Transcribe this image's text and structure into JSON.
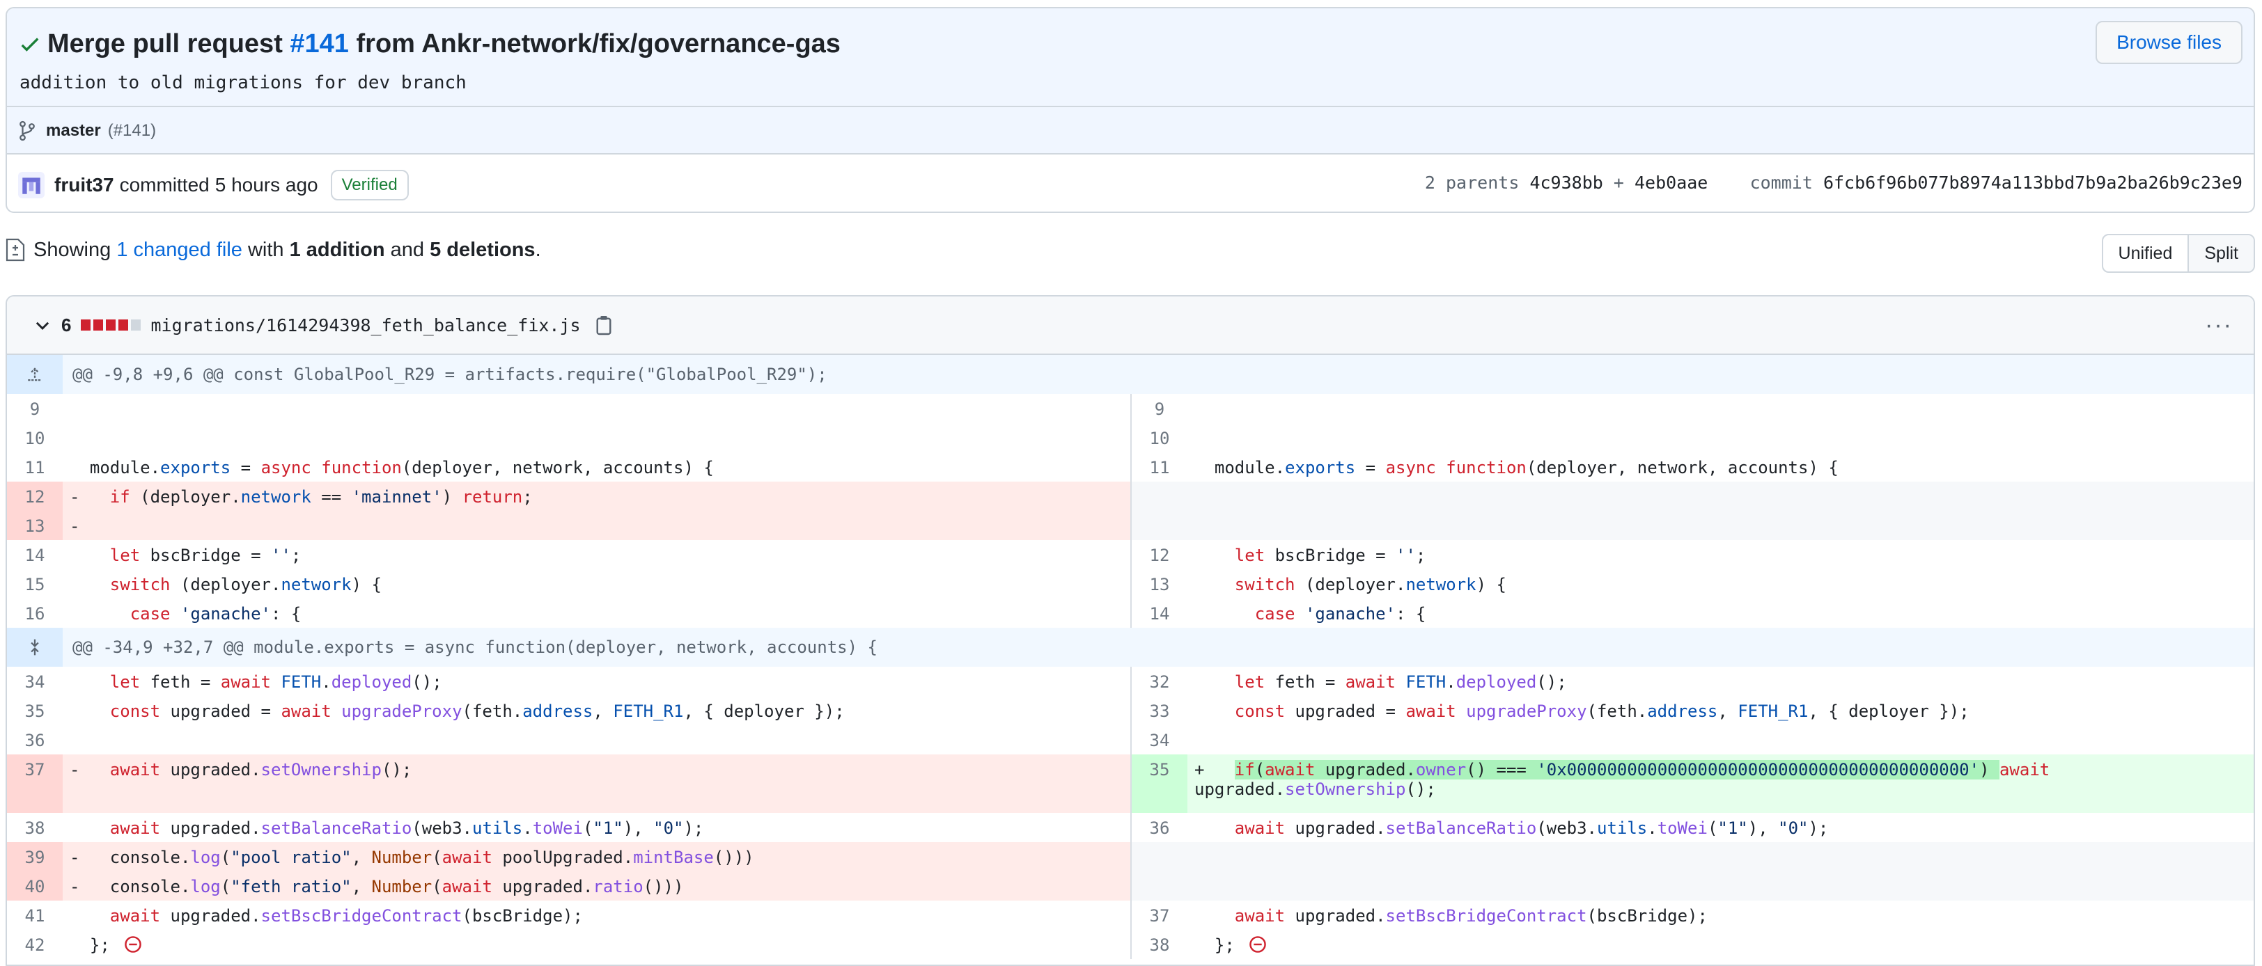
{
  "commit": {
    "title_prefix": "Merge pull request",
    "pr_number": "#141",
    "title_suffix": "from Ankr-network/fix/governance-gas",
    "description": "addition to old migrations for dev branch",
    "branch": "master",
    "branch_pr": "(#141)",
    "browse_label": "Browse files",
    "author": "fruit37",
    "committed_label": "committed",
    "time_ago": "5 hours ago",
    "verified_label": "Verified",
    "parents_label": "2 parents",
    "parent1": "4c938bb",
    "parent_sep": "+",
    "parent2": "4eb0aae",
    "commit_label": "commit",
    "sha": "6fcb6f96b077b8974a113bbd7b9a2ba26b9c23e9"
  },
  "summary": {
    "showing": "Showing",
    "changed": "1 changed file",
    "with": "with",
    "additions": "1 addition",
    "and": "and",
    "deletions": "5 deletions",
    "period": "."
  },
  "view_toggle": {
    "unified": "Unified",
    "split": "Split",
    "active": "Split"
  },
  "file": {
    "change_count": "6",
    "blocks": [
      "del",
      "del",
      "del",
      "del",
      "neutral"
    ],
    "name": "migrations/1614294398_feth_balance_fix.js",
    "hunk1": "@@ -9,8 +9,6 @@ const GlobalPool_R29 = artifacts.require(\"GlobalPool_R29\");",
    "hunk2": "@@ -34,9 +32,7 @@ module.exports = async function(deployer, network, accounts) {"
  },
  "colors": {
    "accent": "#0969da",
    "del": "#cf222e",
    "add": "#1a7f37"
  }
}
